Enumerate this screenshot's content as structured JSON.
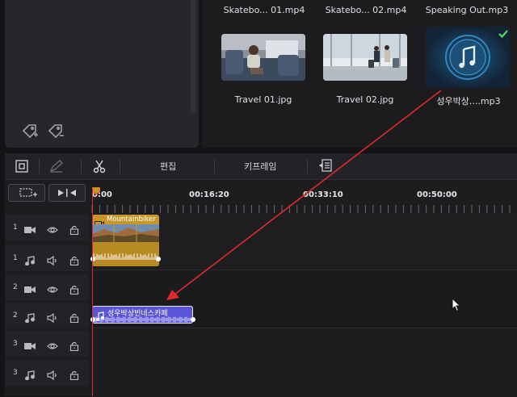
{
  "media": {
    "items": [
      {
        "label": "Skatebo... 01.mp4"
      },
      {
        "label": "Skatebo... 02.mp4"
      },
      {
        "label": "Speaking Out.mp3"
      },
      {
        "label": "Travel 01.jpg"
      },
      {
        "label": "Travel 02.jpg"
      },
      {
        "label": "성우박상....mp3"
      }
    ]
  },
  "toolbar": {
    "edit_label": "편집",
    "keyframe_label": "키프레임"
  },
  "ruler": {
    "ticks": [
      "0:00",
      "00:16:20",
      "00:33:10",
      "00:50:00"
    ]
  },
  "tracks": [
    {
      "number": "1",
      "type": "video"
    },
    {
      "number": "1",
      "type": "audio"
    },
    {
      "number": "2",
      "type": "video"
    },
    {
      "number": "2",
      "type": "audio"
    },
    {
      "number": "3",
      "type": "video"
    },
    {
      "number": "3",
      "type": "audio"
    }
  ],
  "clips": {
    "video_clip_label": "Mountainbiker",
    "audio_clip_label": "성우박상빈네스카페"
  },
  "colors": {
    "accent_red": "#e02a2a",
    "video_clip": "#c9962a",
    "audio_clip": "#5a55d6",
    "check_green": "#4cd964"
  }
}
